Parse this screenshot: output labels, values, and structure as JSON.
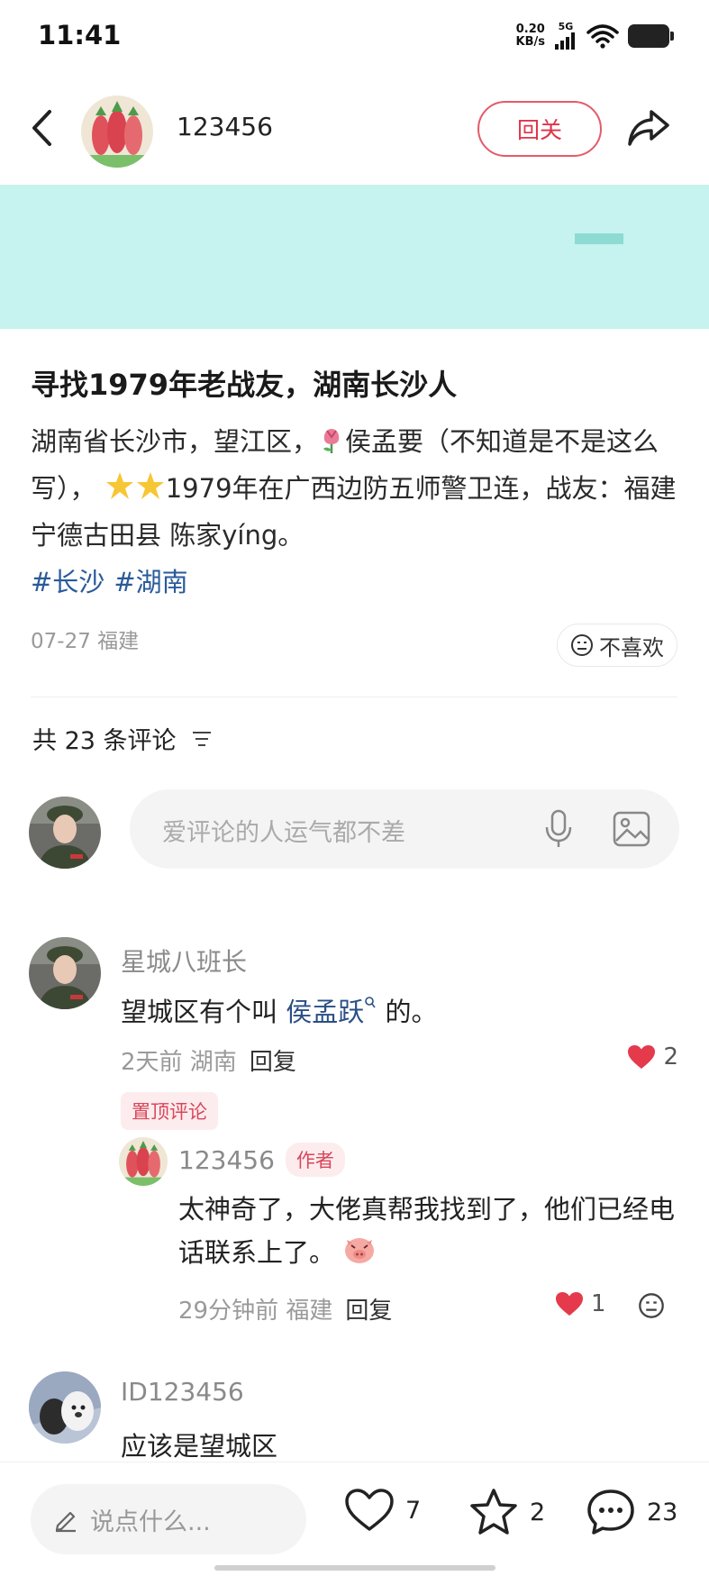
{
  "status_bar": {
    "time": "11:41",
    "net_speed_value": "0.20",
    "net_speed_unit": "KB/s",
    "network": "5G",
    "icons": [
      "signal-icon",
      "wifi-icon",
      "battery-icon"
    ]
  },
  "nav": {
    "username": "123456",
    "follow_label": "回关",
    "icons": [
      "back-arrow-icon",
      "share-icon"
    ]
  },
  "post": {
    "title": "寻找1979年老战友，湖南长沙人",
    "body_part1": "湖南省长沙市，望江区，",
    "body_part2": "侯孟要（不知道是不是这么写），",
    "body_part3": "1979年在广西边防五师警卫连，战友：福建宁德古田县 陈家yíng。",
    "tags": [
      "#长沙",
      "#湖南"
    ],
    "meta": "07-27 福建",
    "dislike_label": "不喜欢"
  },
  "comments_header": {
    "count_label": "共 23 条评论"
  },
  "comment_input": {
    "placeholder": "爱评论的人运气都不差"
  },
  "comments": [
    {
      "author": "星城八班长",
      "text_before": "望城区有个叫 ",
      "link": "侯孟跃",
      "text_after": " 的。",
      "meta": "2天前 湖南",
      "reply_label": "回复",
      "likes": "2",
      "badge": "置顶评论"
    },
    {
      "author": "ID123456",
      "text": "应该是望城区"
    }
  ],
  "reply": {
    "author": "123456",
    "badge": "作者",
    "text": "太神奇了，大佬真帮我找到了，他们已经电话联系上了。",
    "meta": "29分钟前 福建",
    "reply_label": "回复",
    "likes": "1"
  },
  "bottom_bar": {
    "placeholder": "说点什么...",
    "likes": "7",
    "favorites": "2",
    "comments": "23"
  },
  "colors": {
    "accent_red": "#e0334a",
    "banner": "#c6f2ef",
    "tag_blue": "#2a5a9a"
  }
}
